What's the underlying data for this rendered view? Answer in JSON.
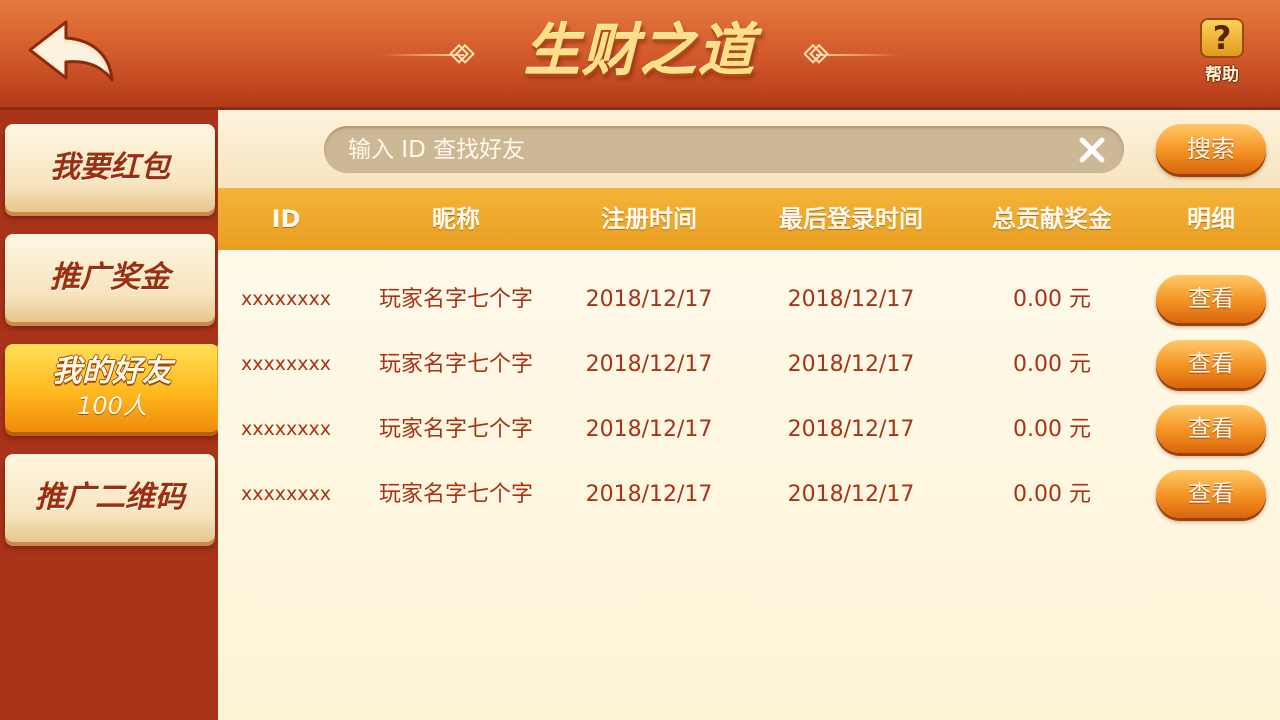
{
  "header": {
    "title": "生财之道",
    "help_label": "帮助",
    "help_glyph": "?"
  },
  "sidebar": {
    "items": [
      {
        "label": "我要红包"
      },
      {
        "label": "推广奖金"
      },
      {
        "label": "我的好友",
        "count": "100人",
        "active": true
      },
      {
        "label": "推广二维码"
      }
    ]
  },
  "search": {
    "placeholder": "输入 ID 查找好友",
    "value": "",
    "button_label": "搜索"
  },
  "table": {
    "columns": [
      "ID",
      "昵称",
      "注册时间",
      "最后登录时间",
      "总贡献奖金",
      "明细"
    ],
    "rows": [
      {
        "id": "xxxxxxxx",
        "nickname": "玩家名字七个字",
        "register_time": "2018/12/17",
        "last_login": "2018/12/17",
        "bonus": "0.00 元",
        "action": "查看"
      },
      {
        "id": "xxxxxxxx",
        "nickname": "玩家名字七个字",
        "register_time": "2018/12/17",
        "last_login": "2018/12/17",
        "bonus": "0.00 元",
        "action": "查看"
      },
      {
        "id": "xxxxxxxx",
        "nickname": "玩家名字七个字",
        "register_time": "2018/12/17",
        "last_login": "2018/12/17",
        "bonus": "0.00 元",
        "action": "查看"
      },
      {
        "id": "xxxxxxxx",
        "nickname": "玩家名字七个字",
        "register_time": "2018/12/17",
        "last_login": "2018/12/17",
        "bonus": "0.00 元",
        "action": "查看"
      }
    ]
  },
  "icons": {
    "back": "back-arrow-icon",
    "help": "help-icon",
    "clear": "close-icon",
    "title_ornament": "diamond-ornament-icon"
  },
  "colors": {
    "header_red": "#d1582a",
    "sidebar_red": "#a8341a",
    "table_header_gold": "#e89e20",
    "text_red": "#a83316",
    "button_orange": "#f39222",
    "panel_cream": "#fffbf0"
  }
}
